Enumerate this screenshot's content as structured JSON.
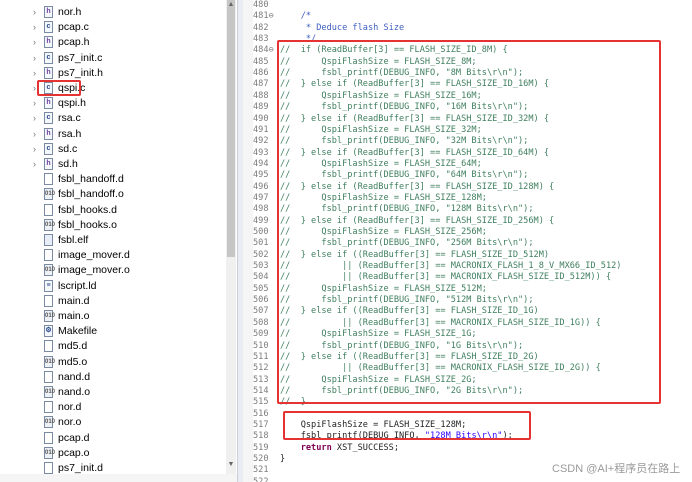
{
  "explorer": {
    "items": [
      {
        "name": "nor.h",
        "type": "h",
        "expandable": true
      },
      {
        "name": "pcap.c",
        "type": "c",
        "expandable": true
      },
      {
        "name": "pcap.h",
        "type": "h",
        "expandable": true
      },
      {
        "name": "ps7_init.c",
        "type": "c",
        "expandable": true
      },
      {
        "name": "ps7_init.h",
        "type": "h",
        "expandable": true
      },
      {
        "name": "qspi.c",
        "type": "c",
        "expandable": true
      },
      {
        "name": "qspi.h",
        "type": "h",
        "expandable": true
      },
      {
        "name": "rsa.c",
        "type": "c",
        "expandable": true
      },
      {
        "name": "rsa.h",
        "type": "h",
        "expandable": true
      },
      {
        "name": "sd.c",
        "type": "c",
        "expandable": true
      },
      {
        "name": "sd.h",
        "type": "h",
        "expandable": true
      },
      {
        "name": "fsbl_handoff.d",
        "type": "d",
        "expandable": false
      },
      {
        "name": "fsbl_handoff.o",
        "type": "o",
        "expandable": false
      },
      {
        "name": "fsbl_hooks.d",
        "type": "d",
        "expandable": false
      },
      {
        "name": "fsbl_hooks.o",
        "type": "o",
        "expandable": false
      },
      {
        "name": "fsbl.elf",
        "type": "elf",
        "expandable": false
      },
      {
        "name": "image_mover.d",
        "type": "d",
        "expandable": false
      },
      {
        "name": "image_mover.o",
        "type": "o",
        "expandable": false
      },
      {
        "name": "lscript.ld",
        "type": "ld",
        "expandable": false
      },
      {
        "name": "main.d",
        "type": "d",
        "expandable": false
      },
      {
        "name": "main.o",
        "type": "o",
        "expandable": false
      },
      {
        "name": "Makefile",
        "type": "mk",
        "expandable": false
      },
      {
        "name": "md5.d",
        "type": "d",
        "expandable": false
      },
      {
        "name": "md5.o",
        "type": "o",
        "expandable": false
      },
      {
        "name": "nand.d",
        "type": "d",
        "expandable": false
      },
      {
        "name": "nand.o",
        "type": "o",
        "expandable": false
      },
      {
        "name": "nor.d",
        "type": "d",
        "expandable": false
      },
      {
        "name": "nor.o",
        "type": "o",
        "expandable": false
      },
      {
        "name": "pcap.d",
        "type": "d",
        "expandable": false
      },
      {
        "name": "pcap.o",
        "type": "o",
        "expandable": false
      },
      {
        "name": "ps7_init.d",
        "type": "d",
        "expandable": false
      }
    ],
    "selected": "qspi.c"
  },
  "editor": {
    "lines": [
      {
        "n": "480",
        "segs": []
      },
      {
        "n": "481⊖",
        "segs": [
          {
            "t": "    /*",
            "c": "comment-doc"
          }
        ]
      },
      {
        "n": "482",
        "segs": [
          {
            "t": "     * Deduce flash Size",
            "c": "comment-doc"
          }
        ]
      },
      {
        "n": "483",
        "segs": [
          {
            "t": "     */",
            "c": "comment-doc"
          }
        ]
      },
      {
        "n": "484⊖",
        "segs": [
          {
            "t": "//  if (ReadBuffer[3] == FLASH_SIZE_ID_8M) {",
            "c": "comment"
          }
        ]
      },
      {
        "n": "485",
        "segs": [
          {
            "t": "//      QspiFlashSize = FLASH_SIZE_8M;",
            "c": "comment"
          }
        ]
      },
      {
        "n": "486",
        "segs": [
          {
            "t": "//      fsbl_printf(DEBUG_INFO, \"8M Bits\\r\\n\");",
            "c": "comment"
          }
        ]
      },
      {
        "n": "487",
        "segs": [
          {
            "t": "//  } else if (ReadBuffer[3] == FLASH_SIZE_ID_16M) {",
            "c": "comment"
          }
        ]
      },
      {
        "n": "488",
        "segs": [
          {
            "t": "//      QspiFlashSize = FLASH_SIZE_16M;",
            "c": "comment"
          }
        ]
      },
      {
        "n": "489",
        "segs": [
          {
            "t": "//      fsbl_printf(DEBUG_INFO, \"16M Bits\\r\\n\");",
            "c": "comment"
          }
        ]
      },
      {
        "n": "490",
        "segs": [
          {
            "t": "//  } else if (ReadBuffer[3] == FLASH_SIZE_ID_32M) {",
            "c": "comment"
          }
        ]
      },
      {
        "n": "491",
        "segs": [
          {
            "t": "//      QspiFlashSize = FLASH_SIZE_32M;",
            "c": "comment"
          }
        ]
      },
      {
        "n": "492",
        "segs": [
          {
            "t": "//      fsbl_printf(DEBUG_INFO, \"32M Bits\\r\\n\");",
            "c": "comment"
          }
        ]
      },
      {
        "n": "493",
        "segs": [
          {
            "t": "//  } else if (ReadBuffer[3] == FLASH_SIZE_ID_64M) {",
            "c": "comment"
          }
        ]
      },
      {
        "n": "494",
        "segs": [
          {
            "t": "//      QspiFlashSize = FLASH_SIZE_64M;",
            "c": "comment"
          }
        ]
      },
      {
        "n": "495",
        "segs": [
          {
            "t": "//      fsbl_printf(DEBUG_INFO, \"64M Bits\\r\\n\");",
            "c": "comment"
          }
        ]
      },
      {
        "n": "496",
        "segs": [
          {
            "t": "//  } else if (ReadBuffer[3] == FLASH_SIZE_ID_128M) {",
            "c": "comment"
          }
        ]
      },
      {
        "n": "497",
        "segs": [
          {
            "t": "//      QspiFlashSize = FLASH_SIZE_128M;",
            "c": "comment"
          }
        ]
      },
      {
        "n": "498",
        "segs": [
          {
            "t": "//      fsbl_printf(DEBUG_INFO, \"128M Bits\\r\\n\");",
            "c": "comment"
          }
        ]
      },
      {
        "n": "499",
        "segs": [
          {
            "t": "//  } else if (ReadBuffer[3] == FLASH_SIZE_ID_256M) {",
            "c": "comment"
          }
        ]
      },
      {
        "n": "500",
        "segs": [
          {
            "t": "//      QspiFlashSize = FLASH_SIZE_256M;",
            "c": "comment"
          }
        ]
      },
      {
        "n": "501",
        "segs": [
          {
            "t": "//      fsbl_printf(DEBUG_INFO, \"256M Bits\\r\\n\");",
            "c": "comment"
          }
        ]
      },
      {
        "n": "502",
        "segs": [
          {
            "t": "//  } else if ((ReadBuffer[3] == FLASH_SIZE_ID_512M)",
            "c": "comment"
          }
        ]
      },
      {
        "n": "503",
        "segs": [
          {
            "t": "//          || (ReadBuffer[3] == MACRONIX_FLASH_1_8_V_MX66_ID_512)",
            "c": "comment"
          }
        ]
      },
      {
        "n": "504",
        "segs": [
          {
            "t": "//          || (ReadBuffer[3] == MACRONIX_FLASH_SIZE_ID_512M)) {",
            "c": "comment"
          }
        ]
      },
      {
        "n": "505",
        "segs": [
          {
            "t": "//      QspiFlashSize = FLASH_SIZE_512M;",
            "c": "comment"
          }
        ]
      },
      {
        "n": "506",
        "segs": [
          {
            "t": "//      fsbl_printf(DEBUG_INFO, \"512M Bits\\r\\n\");",
            "c": "comment"
          }
        ]
      },
      {
        "n": "507",
        "segs": [
          {
            "t": "//  } else if ((ReadBuffer[3] == FLASH_SIZE_ID_1G)",
            "c": "comment"
          }
        ]
      },
      {
        "n": "508",
        "segs": [
          {
            "t": "//          || (ReadBuffer[3] == MACRONIX_FLASH_SIZE_ID_1G)) {",
            "c": "comment"
          }
        ]
      },
      {
        "n": "509",
        "segs": [
          {
            "t": "//      QspiFlashSize = FLASH_SIZE_1G;",
            "c": "comment"
          }
        ]
      },
      {
        "n": "510",
        "segs": [
          {
            "t": "//      fsbl_printf(DEBUG_INFO, \"1G Bits\\r\\n\");",
            "c": "comment"
          }
        ]
      },
      {
        "n": "511",
        "segs": [
          {
            "t": "//  } else if ((ReadBuffer[3] == FLASH_SIZE_ID_2G)",
            "c": "comment"
          }
        ]
      },
      {
        "n": "512",
        "segs": [
          {
            "t": "//          || (ReadBuffer[3] == MACRONIX_FLASH_SIZE_ID_2G)) {",
            "c": "comment"
          }
        ]
      },
      {
        "n": "513",
        "segs": [
          {
            "t": "//      QspiFlashSize = FLASH_SIZE_2G;",
            "c": "comment"
          }
        ]
      },
      {
        "n": "514",
        "segs": [
          {
            "t": "//      fsbl_printf(DEBUG_INFO, \"2G Bits\\r\\n\");",
            "c": "comment"
          }
        ]
      },
      {
        "n": "515",
        "segs": [
          {
            "t": "//  }",
            "c": "comment"
          }
        ]
      },
      {
        "n": "516",
        "segs": []
      },
      {
        "n": "517",
        "segs": [
          {
            "t": "    QspiFlashSize = FLASH_SIZE_128M;",
            "c": ""
          }
        ]
      },
      {
        "n": "518",
        "segs": [
          {
            "t": "    fsbl_printf(DEBUG_INFO, ",
            "c": ""
          },
          {
            "t": "\"128M Bits\\r\\n\"",
            "c": "str"
          },
          {
            "t": ");",
            "c": ""
          }
        ]
      },
      {
        "n": "519",
        "segs": [
          {
            "t": "    ",
            "c": ""
          },
          {
            "t": "return",
            "c": "kw"
          },
          {
            "t": " XST_SUCCESS;",
            "c": ""
          }
        ]
      },
      {
        "n": "520",
        "segs": [
          {
            "t": "}",
            "c": ""
          }
        ]
      },
      {
        "n": "521",
        "segs": []
      },
      {
        "n": "522",
        "segs": []
      }
    ]
  },
  "watermark": "CSDN @AI+程序员在路上",
  "colors": {
    "highlight_red": "#e53333",
    "comment_green": "#3f7f5f",
    "doc_blue": "#3f5fbf",
    "string_blue": "#2a00ff",
    "keyword_purple": "#7f0055"
  }
}
